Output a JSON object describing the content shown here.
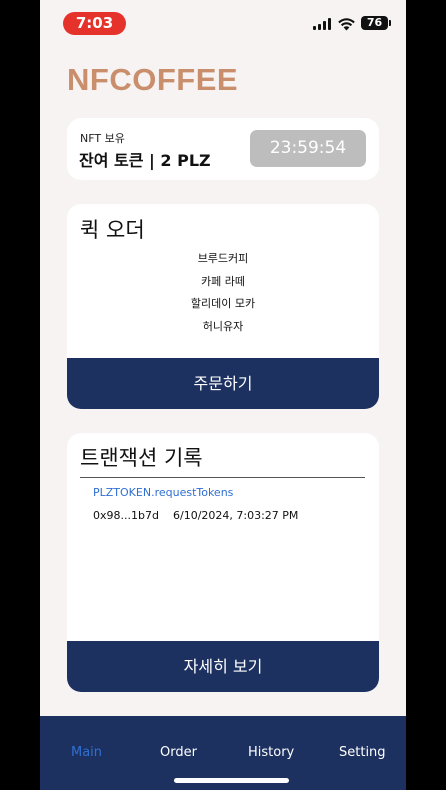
{
  "status_bar": {
    "time": "7:03",
    "battery": "76",
    "time_pill_color": "#e5332c"
  },
  "app": {
    "title": "NFCOFFEE",
    "title_color": "#c98f6d",
    "accent_color": "#1d3160"
  },
  "token": {
    "nft_label": "NFT 보유",
    "balance": "잔여 토큰 | 2 PLZ",
    "timer": "23:59:54"
  },
  "quick_order": {
    "title": "퀵 오더",
    "items": [
      "브루드커피",
      "카페 라떼",
      "할리데이 모카",
      "허니유자"
    ],
    "order_button": "주문하기"
  },
  "transactions": {
    "title": "트랜잭션 기록",
    "entries": [
      {
        "method": "PLZTOKEN.requestTokens",
        "hash": "0x98...1b7d",
        "timestamp": "6/10/2024, 7:03:27 PM"
      }
    ],
    "detail_button": "자세히 보기"
  },
  "nav": {
    "items": [
      {
        "label": "Main",
        "active": true
      },
      {
        "label": "Order",
        "active": false
      },
      {
        "label": "History",
        "active": false
      },
      {
        "label": "Setting",
        "active": false
      }
    ]
  }
}
